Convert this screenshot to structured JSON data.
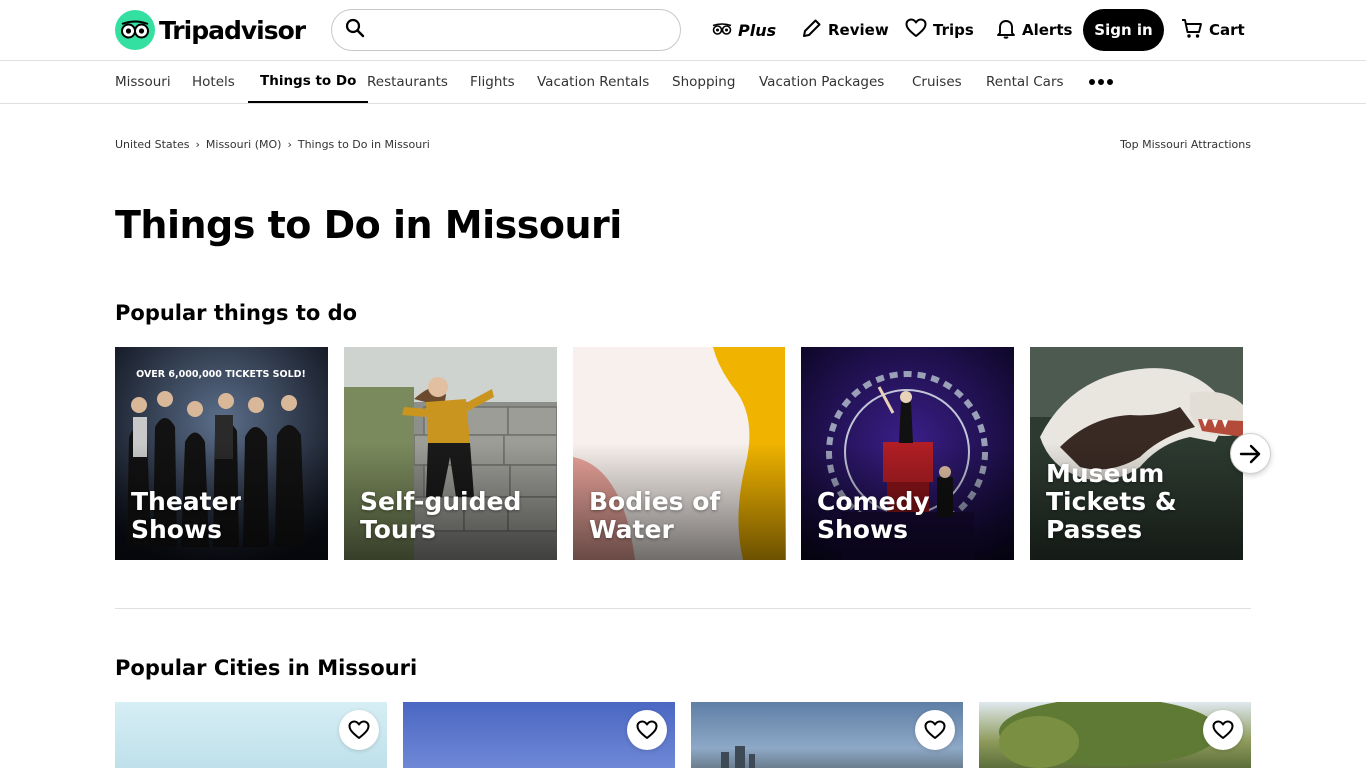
{
  "header": {
    "logo_text": "Tripadvisor",
    "search_placeholder": "",
    "nav": {
      "plus": "Plus",
      "review": "Review",
      "trips": "Trips",
      "alerts": "Alerts",
      "signin": "Sign in",
      "cart": "Cart"
    }
  },
  "subnav": {
    "items": [
      "Missouri",
      "Hotels",
      "Things to Do",
      "Restaurants",
      "Flights",
      "Vacation Rentals",
      "Shopping",
      "Vacation Packages",
      "Cruises",
      "Rental Cars"
    ],
    "active": "Things to Do"
  },
  "breadcrumb": {
    "items": [
      "United States",
      "Missouri (MO)",
      "Things to Do in Missouri"
    ],
    "right_link": "Top Missouri Attractions"
  },
  "page_title": "Things to Do in Missouri",
  "popular_things": {
    "title": "Popular things to do",
    "cards": [
      "Theater Shows",
      "Self-guided Tours",
      "Bodies of Water",
      "Comedy Shows",
      "Museum Tickets & Passes"
    ],
    "poster_text": "OVER 6,000,000 TICKETS SOLD!"
  },
  "popular_cities": {
    "title": "Popular Cities in Missouri"
  },
  "colors": {
    "brand": "#34e0a1",
    "text": "#000000",
    "border": "#e0e0e0"
  }
}
